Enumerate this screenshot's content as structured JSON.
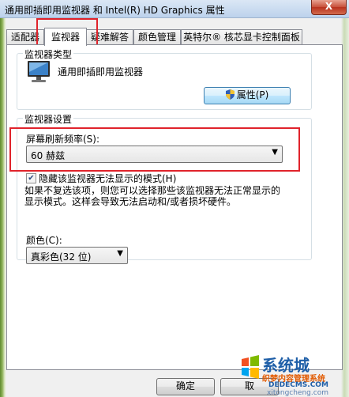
{
  "window": {
    "title": "通用即插即用监视器 和 Intel(R) HD Graphics 属性",
    "close_label": "X"
  },
  "tabs": [
    {
      "label": "适配器"
    },
    {
      "label": "监视器"
    },
    {
      "label": "疑难解答"
    },
    {
      "label": "颜色管理"
    },
    {
      "label": "英特尔® 核芯显卡控制面板"
    }
  ],
  "monitor_type": {
    "legend": "监视器类型",
    "name": "通用即插即用监视器",
    "properties_button": "属性(P)"
  },
  "monitor_settings": {
    "legend": "监视器设置",
    "refresh_label": "屏幕刷新频率(S):",
    "refresh_value": "60 赫兹",
    "hide_modes_checked": true,
    "hide_modes_label": "隐藏该监视器无法显示的模式(H)",
    "description_line1": "如果不复选该项，则您可以选择那些该监视器无法正常显示的",
    "description_line2": "显示模式。这样会导致无法启动和/或者损坏硬件。"
  },
  "colors": {
    "label": "颜色(C):",
    "value": "真彩色(32 位)"
  },
  "footer": {
    "ok_label": "确定",
    "cancel_label": "取"
  },
  "watermark": {
    "brand": "系统城",
    "site_text": "织梦内容管理系统",
    "site_url": "DEDECMS.COM",
    "bottom_url": "xitongcheng.com"
  }
}
